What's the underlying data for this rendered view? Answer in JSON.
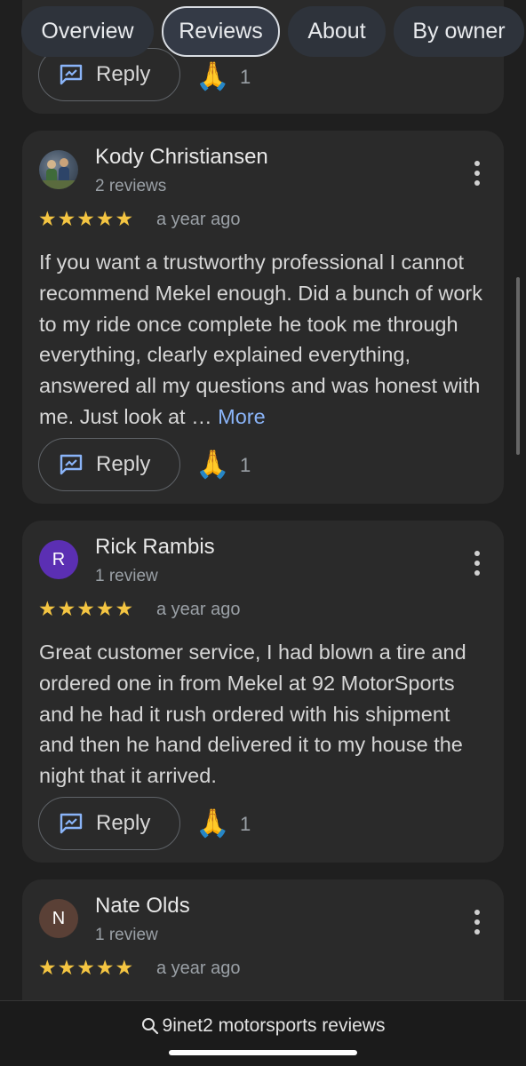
{
  "tabs": [
    {
      "label": "Overview"
    },
    {
      "label": "Reviews"
    },
    {
      "label": "About"
    },
    {
      "label": "By owner"
    }
  ],
  "top_partial": {
    "reply_label": "Reply",
    "reaction_emoji": "🙏",
    "reaction_count": "1"
  },
  "reviews": [
    {
      "name": "Kody Christiansen",
      "count": "2 reviews",
      "rating": 5,
      "stars": "★★★★★",
      "date": "a year ago",
      "text": "If you want a trustworthy professional I cannot recommend Mekel enough. Did a bunch of work to my ride once complete he took me through everything, clearly explained everything, answered all my questions and was honest with me. Just look at …",
      "more": "More",
      "reply_label": "Reply",
      "reaction_emoji": "🙏",
      "reaction_count": "1"
    },
    {
      "name": "Rick Rambis",
      "count": "1 review",
      "avatar_letter": "R",
      "avatar_color": "#5b2fb3",
      "rating": 5,
      "stars": "★★★★★",
      "date": "a year ago",
      "text": "Great customer service, I had blown a tire and ordered one in from Mekel at 92 MotorSports and he had it rush ordered with his shipment and then he hand delivered it to my house the night that it arrived.",
      "reply_label": "Reply",
      "reaction_emoji": "🙏",
      "reaction_count": "1"
    },
    {
      "name": "Nate Olds",
      "count": "1 review",
      "avatar_letter": "N",
      "avatar_color": "#5a4036",
      "rating": 5,
      "stars": "★★★★★",
      "date": "a year ago"
    }
  ],
  "search": {
    "label": "9inet2 motorsports reviews",
    "icon": "search-icon"
  }
}
